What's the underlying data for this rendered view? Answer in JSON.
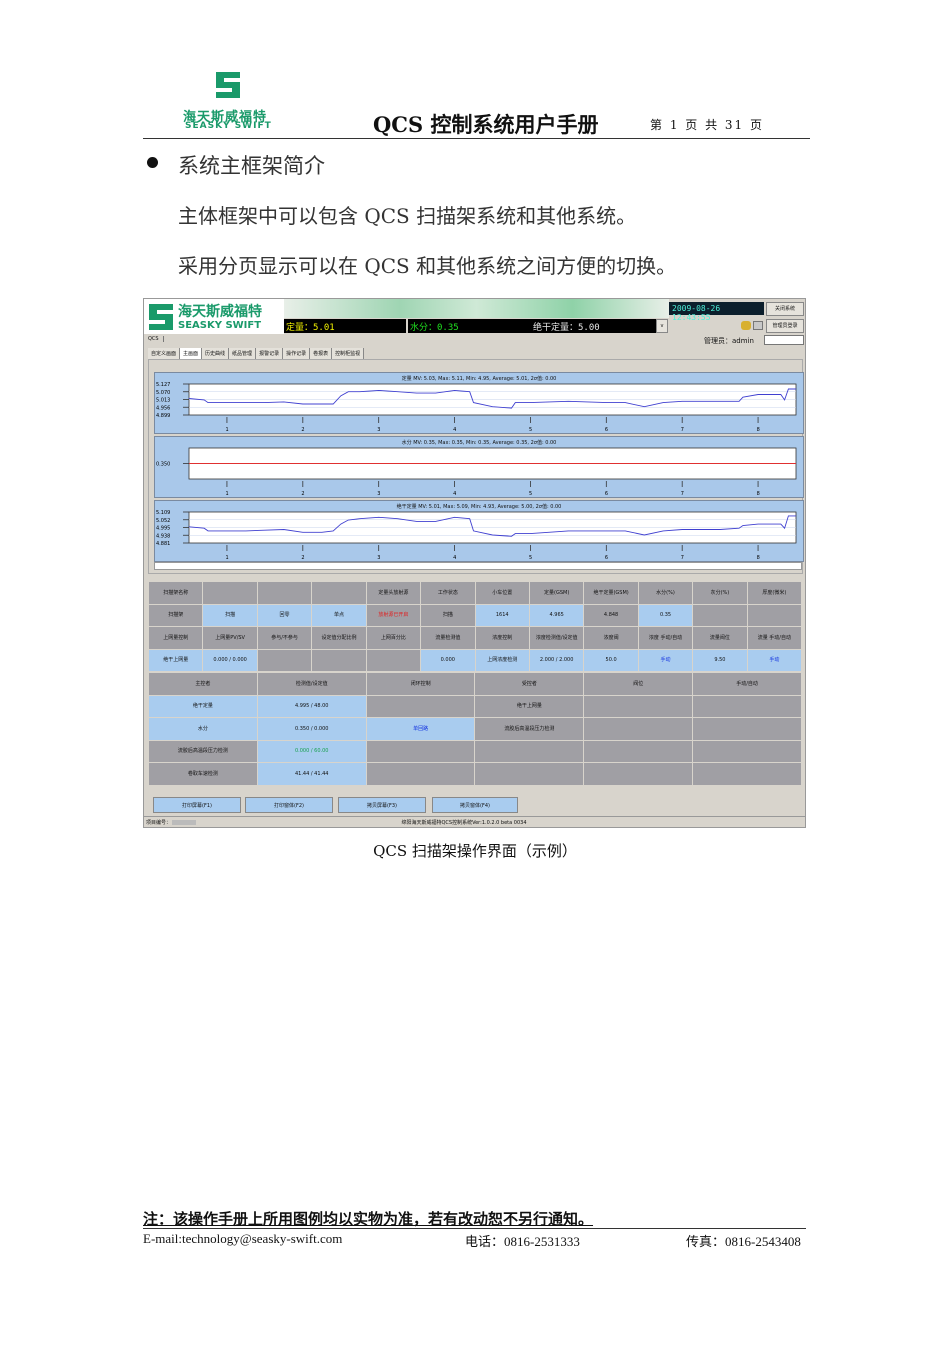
{
  "header": {
    "logo_cn": "海天斯威福特",
    "logo_en": "SEASKY SWIFT",
    "title": "QCS 控制系统用户手册",
    "page_info": "第 1 页 共 31 页"
  },
  "section": {
    "heading": "系统主框架简介",
    "para1": "主体框架中可以包含 QCS 扫描架系统和其他系统。",
    "para2": "采用分页显示可以在 QCS 和其他系统之间方便的切换。"
  },
  "app": {
    "logo_cn": "海天斯威福特",
    "logo_en": "SEASKY SWIFT",
    "datetime": "2009-08-26 12:43:55",
    "close_btn": "关闭系统",
    "login_btn": "管理员登录",
    "meas": [
      {
        "label": "定量：5.01",
        "color": "#f0f000"
      },
      {
        "label": "水分：0.35",
        "color": "#20e020"
      },
      {
        "label": "绝干定量：5.00",
        "color": "#e8e8e8"
      }
    ],
    "dropdown_arrow": "v",
    "system_tab": "QCS",
    "user": "管理员：admin",
    "tabs": [
      "自定义画面",
      "主画面",
      "历史曲线",
      "纸品管理",
      "报警记录",
      "操作记录",
      "卷报表",
      "控制柜监视"
    ],
    "active_tab": 1,
    "f_buttons": [
      "打印屏幕(F1)",
      "打印窗体(F2)",
      "拷贝屏幕(F3)",
      "拷贝窗体(F4)"
    ],
    "status_left": "项目编号：",
    "status_center": "绵阳海天斯威福特QCS控制系统Ver:1.0.2.0 beta 0034",
    "grid_top": [
      [
        [
          "扫描架名称",
          "g"
        ],
        [
          "",
          "g"
        ],
        [
          "",
          "g"
        ],
        [
          "",
          "g"
        ],
        [
          "定量头放射源",
          "g"
        ],
        [
          "工作状态",
          "g"
        ],
        [
          "小车位置",
          "g"
        ],
        [
          "定量(GSM)",
          "g"
        ],
        [
          "绝干定量(GSM)",
          "g"
        ],
        [
          "水分(%)",
          "g"
        ],
        [
          "灰分(%)",
          "g"
        ],
        [
          "厚度(微米)",
          "g"
        ]
      ],
      [
        [
          "扫描架",
          "g"
        ],
        [
          "扫描",
          "b"
        ],
        [
          "回零",
          "b"
        ],
        [
          "单点",
          "b"
        ],
        [
          "放射源已开启",
          "g",
          "r"
        ],
        [
          "扫描",
          "g"
        ],
        [
          "1614",
          "b"
        ],
        [
          "4.965",
          "b"
        ],
        [
          "4.848",
          "g"
        ],
        [
          "0.35",
          "b"
        ],
        [
          "",
          "g"
        ],
        [
          "",
          "g"
        ]
      ],
      [
        [
          "上网量控制",
          "g"
        ],
        [
          "上网量PV/SV",
          "g"
        ],
        [
          "参与/不参与",
          "g"
        ],
        [
          "设定值分配比例",
          "g"
        ],
        [
          "上网百分比",
          "g"
        ],
        [
          "流量检测值",
          "g"
        ],
        [
          "浓度控制",
          "g"
        ],
        [
          "浓度检测值/设定值",
          "g"
        ],
        [
          "浓度阀",
          "g"
        ],
        [
          "浓度 手动/自动",
          "g"
        ],
        [
          "流量阀位",
          "g"
        ],
        [
          "流量 手动/自动",
          "g"
        ]
      ],
      [
        [
          "绝干上网量",
          "b"
        ],
        [
          "0.000 / 0.000",
          "b"
        ],
        [
          "",
          "g"
        ],
        [
          "",
          "g"
        ],
        [
          "",
          "g"
        ],
        [
          "0.000",
          "b"
        ],
        [
          "上网浓度检测",
          "b"
        ],
        [
          "2.000 / 2.000",
          "b"
        ],
        [
          "50.0",
          "b"
        ],
        [
          "手动",
          "b",
          "b"
        ],
        [
          "9.50",
          "b"
        ],
        [
          "手动",
          "b",
          "b"
        ]
      ]
    ],
    "grid_bottom": [
      [
        [
          "主控者",
          "g"
        ],
        [
          "检测值/设定值",
          "g"
        ],
        [
          "闭环控制",
          "g"
        ],
        [
          "受控者",
          "g"
        ],
        [
          "阀位",
          "g"
        ],
        [
          "手动/自动",
          "g"
        ]
      ],
      [
        [
          "绝干定量",
          "b"
        ],
        [
          "4.995 / 48.00",
          "b"
        ],
        [
          "",
          "g"
        ],
        [
          "绝干上网量",
          "g"
        ],
        [
          "",
          "g"
        ],
        [
          "",
          "g"
        ]
      ],
      [
        [
          "水分",
          "b"
        ],
        [
          "0.350 / 0.000",
          "b"
        ],
        [
          "单回路",
          "b",
          "b"
        ],
        [
          "流胶后高温段压力检测",
          "g"
        ],
        [
          "",
          "g"
        ],
        [
          "",
          "g"
        ]
      ],
      [
        [
          "流胶后高温段压力检测",
          "g"
        ],
        [
          "0.000 / 60.00",
          "b",
          "gn"
        ],
        [
          "",
          "g"
        ],
        [
          "",
          "g"
        ],
        [
          "",
          "g"
        ],
        [
          "",
          "g"
        ]
      ],
      [
        [
          "卷取车速检测",
          "g"
        ],
        [
          "41.44 / 41.44",
          "b"
        ],
        [
          "",
          "g"
        ],
        [
          "",
          "g"
        ],
        [
          "",
          "g"
        ],
        [
          "",
          "g"
        ]
      ]
    ]
  },
  "chart_data": [
    {
      "type": "line",
      "title": "定量 MV: 5.03, Max: 5.11, Min: 4.95, Average: 5.01, 2σ值: 0.00",
      "yticks": [
        "5.127",
        "5.070",
        "5.013",
        "4.956",
        "4.899"
      ],
      "ylim": [
        4.899,
        5.127
      ],
      "xticks": [
        "1",
        "2",
        "3",
        "4",
        "5",
        "6",
        "7",
        "8"
      ],
      "xlim": [
        0.5,
        8.5
      ],
      "x": [
        0.5,
        0.7,
        0.75,
        1,
        1.25,
        1.5,
        1.75,
        2,
        2.25,
        2.4,
        2.5,
        2.6,
        2.75,
        3,
        3.25,
        3.5,
        3.75,
        4,
        4.2,
        4.25,
        4.5,
        4.75,
        4.8,
        5,
        5.5,
        6,
        6.25,
        6.5,
        6.75,
        7,
        7.5,
        7.75,
        7.8,
        8,
        8.3,
        8.35,
        8.4,
        8.5
      ],
      "y": [
        5.02,
        5.01,
        4.99,
        4.99,
        4.99,
        4.99,
        4.995,
        4.98,
        4.98,
        4.98,
        5.04,
        5.07,
        5.07,
        5.08,
        5.07,
        5.06,
        5.06,
        5.08,
        5.07,
        4.99,
        4.96,
        4.95,
        4.99,
        4.99,
        5.0,
        4.99,
        4.99,
        4.96,
        4.99,
        5.0,
        5.0,
        5.0,
        5.03,
        5.05,
        5.05,
        5.01,
        5.09,
        5.09
      ]
    },
    {
      "type": "line",
      "title": "水分 MV: 0.35, Max: 0.35, Min: 0.35, Average: 0.35, 2σ值: 0.00",
      "yticks": [
        "0.350"
      ],
      "ylim": [
        0.3,
        0.4
      ],
      "xticks": [
        "1",
        "2",
        "3",
        "4",
        "5",
        "6",
        "7",
        "8"
      ],
      "xlim": [
        0.5,
        8.5
      ],
      "x": [
        0.5,
        8.5
      ],
      "y": [
        0.35,
        0.35
      ]
    },
    {
      "type": "line",
      "title": "绝干定量 MV: 5.01, Max: 5.09, Min: 4.93, Average: 5.00, 2σ值: 0.00",
      "yticks": [
        "5.109",
        "5.052",
        "4.995",
        "4.938",
        "4.881"
      ],
      "ylim": [
        4.881,
        5.109
      ],
      "xticks": [
        "1",
        "2",
        "3",
        "4",
        "5",
        "6",
        "7",
        "8"
      ],
      "xlim": [
        0.5,
        8.5
      ],
      "x": [
        0.5,
        0.7,
        0.75,
        1,
        1.25,
        1.5,
        1.75,
        2,
        2.25,
        2.4,
        2.5,
        2.6,
        2.75,
        3,
        3.25,
        3.5,
        3.75,
        4,
        4.2,
        4.25,
        4.5,
        4.75,
        4.8,
        5,
        5.5,
        6,
        6.25,
        6.5,
        6.75,
        7,
        7.5,
        7.75,
        7.8,
        8,
        8.3,
        8.35,
        8.4,
        8.5
      ],
      "y": [
        5.0,
        4.99,
        4.97,
        4.97,
        4.97,
        4.975,
        4.98,
        4.96,
        4.96,
        4.97,
        5.02,
        5.05,
        5.06,
        5.07,
        5.06,
        5.04,
        5.04,
        5.07,
        5.06,
        4.97,
        4.94,
        4.93,
        4.95,
        4.95,
        4.97,
        4.97,
        4.97,
        4.94,
        4.97,
        4.98,
        4.98,
        4.99,
        5.01,
        5.02,
        5.02,
        4.99,
        5.08,
        5.08
      ]
    }
  ],
  "footer": {
    "note": "注：该操作手册上所用图例均以实物为准，若有改动恕不另行通知。",
    "email": "E-mail:technology@seasky-swift.com",
    "phone": "电话：0816-2531333",
    "fax": "传真：0816-2543408"
  },
  "caption": "QCS 扫描架操作界面（示例）"
}
